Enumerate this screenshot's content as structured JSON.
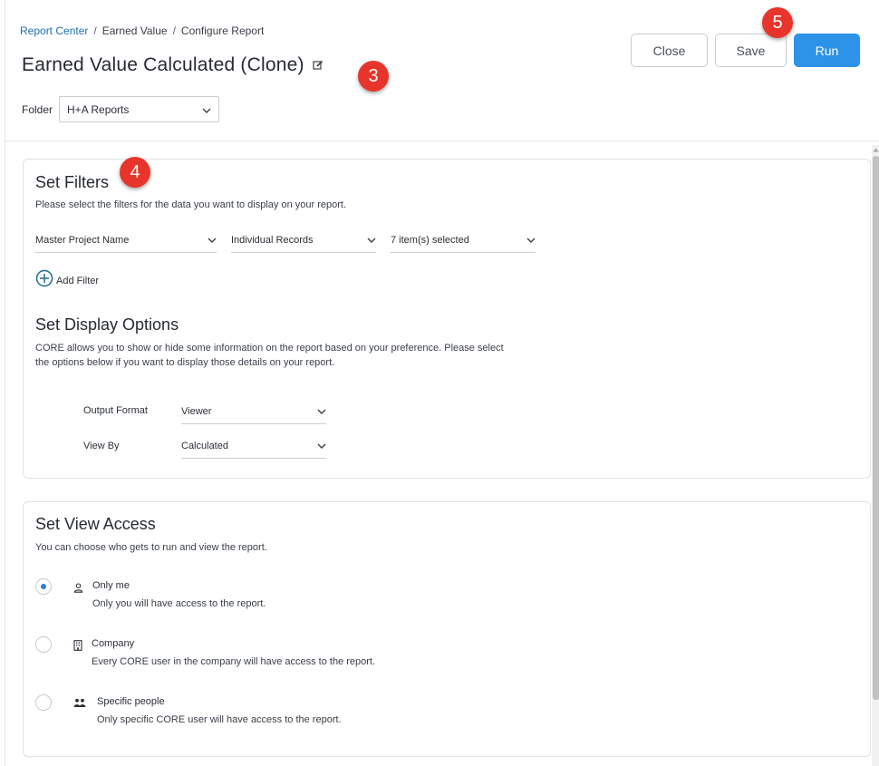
{
  "breadcrumb": {
    "items": [
      "Report Center",
      "Earned Value",
      "Configure Report"
    ],
    "separator": "/"
  },
  "header": {
    "title": "Earned Value Calculated (Clone)",
    "folder_label": "Folder",
    "folder_value": "H+A Reports",
    "close_label": "Close",
    "save_label": "Save",
    "run_label": "Run"
  },
  "badges": {
    "b3": "3",
    "b4": "4",
    "b5": "5"
  },
  "filters": {
    "title": "Set Filters",
    "description": "Please select the filters for the data you want to display on your report.",
    "selects": [
      "Master Project Name",
      "Individual Records",
      "7 item(s) selected"
    ],
    "add_filter_label": "Add Filter"
  },
  "display": {
    "title": "Set Display Options",
    "description_line1": "CORE allows you to show or hide some information on the report based on your preference. Please select",
    "description_line2": "the options below if you want to display those details on your report.",
    "output_format_label": "Output Format",
    "output_format_value": "Viewer",
    "view_by_label": "View By",
    "view_by_value": "Calculated"
  },
  "access": {
    "title": "Set View Access",
    "description": "You can choose who gets to run and view the report.",
    "options": [
      {
        "title": "Only me",
        "desc": "Only you will have access to the report.",
        "icon": "user-icon",
        "checked": true
      },
      {
        "title": "Company",
        "desc": "Every CORE user in the company will have access to the report.",
        "icon": "building-icon",
        "checked": false
      },
      {
        "title": "Specific people",
        "desc": "Only specific CORE user will have access to the report.",
        "icon": "people-icon",
        "checked": false
      }
    ]
  },
  "colors": {
    "primary": "#2c93e8",
    "badge": "#e8352b",
    "link": "#1f6fb3",
    "add_icon": "#1e6f8c"
  }
}
